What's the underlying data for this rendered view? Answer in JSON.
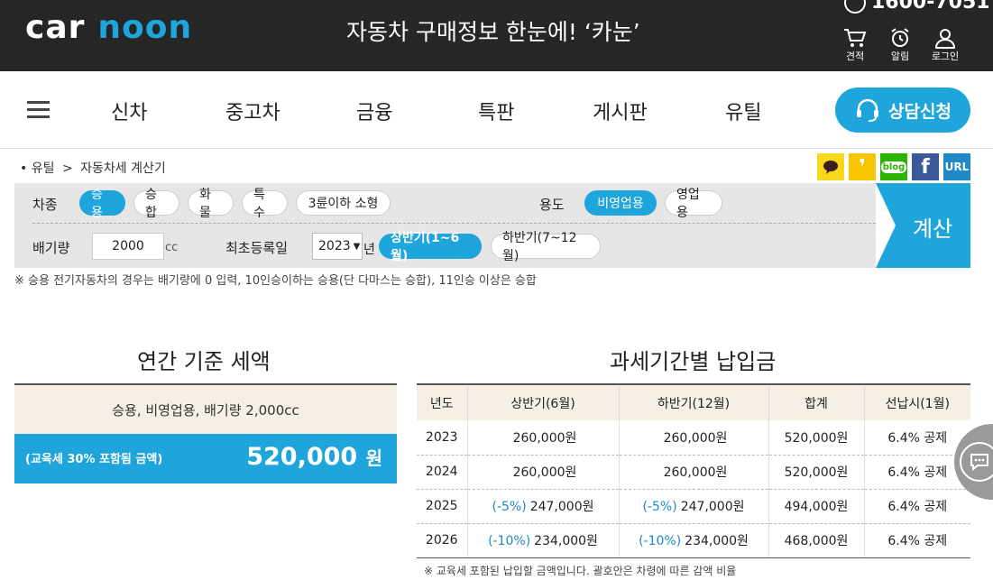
{
  "header": {
    "logo_left": "car",
    "logo_right": "noon",
    "slogan": "자동차 구매정보 한눈에! ‘카눈’",
    "phone": "1600-7051",
    "icons": [
      {
        "label": "견적",
        "icon": "cart-icon"
      },
      {
        "label": "알림",
        "icon": "alarm-clock-icon"
      },
      {
        "label": "로그인",
        "icon": "user-icon"
      }
    ]
  },
  "nav": {
    "items": [
      "신차",
      "중고차",
      "금융",
      "특판",
      "게시판",
      "유틸"
    ],
    "consult_label": "상담신청"
  },
  "breadcrumb": {
    "root": "유틸",
    "separator": ">",
    "current": "자동차세 계산기"
  },
  "socials": [
    {
      "name": "kakaotalk",
      "text": "",
      "color": "#f9d71c"
    },
    {
      "name": "kakaostory",
      "text": "❜",
      "color": "#f9c400"
    },
    {
      "name": "blog",
      "text": "blog",
      "color": "#2db400"
    },
    {
      "name": "facebook",
      "text": "f",
      "color": "#3b5998"
    },
    {
      "name": "url",
      "text": "URL",
      "color": "#1e88c8"
    }
  ],
  "calculator": {
    "type_label": "차종",
    "types": [
      "승용",
      "승합",
      "화물",
      "특수",
      "3륜이하 소형"
    ],
    "type_selected": 0,
    "usage_label": "용도",
    "usages": [
      "비영업용",
      "영업용"
    ],
    "usage_selected": 0,
    "displacement_label": "배기량",
    "displacement_value": "2000",
    "displacement_unit": "cc",
    "reg_label": "최초등록일",
    "reg_year": "2023",
    "reg_year_unit": "년",
    "halves": [
      "상반기(1~6월)",
      "하반기(7~12월)"
    ],
    "half_selected": 0,
    "submit_label": "계산",
    "note": "※ 승용 전기자동차의 경우는 배기량에 0 입력, 10인승이하는 승용(단 다마스는 승합), 11인승 이상은 승합"
  },
  "annual": {
    "title": "연간 기준 세액",
    "summary": "승용, 비영업용, 배기량 2,000cc",
    "included_label": "(교육세 30% 포함됨 금액)",
    "amount": "520,000",
    "amount_unit": "원"
  },
  "period": {
    "title": "과세기간별 납입금",
    "columns": [
      "년도",
      "상반기(6월)",
      "하반기(12월)",
      "합계",
      "선납시(1월)"
    ],
    "rows": [
      {
        "year": "2023",
        "first_disc": "",
        "first": "260,000원",
        "second_disc": "",
        "second": "260,000원",
        "total": "520,000원",
        "prepay": "6.4% 공제"
      },
      {
        "year": "2024",
        "first_disc": "",
        "first": "260,000원",
        "second_disc": "",
        "second": "260,000원",
        "total": "520,000원",
        "prepay": "6.4% 공제"
      },
      {
        "year": "2025",
        "first_disc": "(-5%)",
        "first": "247,000원",
        "second_disc": "(-5%)",
        "second": "247,000원",
        "total": "494,000원",
        "prepay": "6.4% 공제"
      },
      {
        "year": "2026",
        "first_disc": "(-10%)",
        "first": "234,000원",
        "second_disc": "(-10%)",
        "second": "234,000원",
        "total": "468,000원",
        "prepay": "6.4% 공제"
      }
    ],
    "footnote": "※ 교육세 포함된 납입할 금액입니다. 괄호안은 차령에 따른 감액 비율"
  },
  "colors": {
    "accent": "#1ea5dc",
    "topbar": "#262626",
    "panel": "#e6e6e6",
    "beige": "#f5efe6"
  }
}
